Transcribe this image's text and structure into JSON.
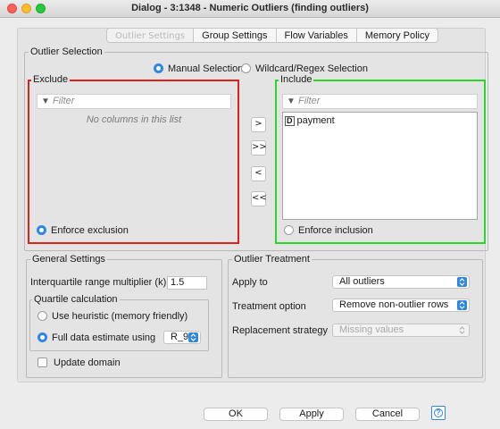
{
  "window": {
    "title": "Dialog - 3:1348 - Numeric Outliers (finding outliers)"
  },
  "tabs": [
    {
      "label": "Outlier Settings"
    },
    {
      "label": "Group Settings"
    },
    {
      "label": "Flow Variables"
    },
    {
      "label": "Memory Policy"
    }
  ],
  "outlier_selection": {
    "legend": "Outlier Selection",
    "mode_manual": "Manual Selection",
    "mode_wildcard": "Wildcard/Regex Selection",
    "exclude": {
      "legend": "Exclude",
      "filter_placeholder": "Filter",
      "empty_text": "No columns in this list",
      "enforce": "Enforce exclusion"
    },
    "include": {
      "legend": "Include",
      "filter_placeholder": "Filter",
      "items": [
        {
          "type": "D",
          "name": "payment"
        }
      ],
      "enforce": "Enforce inclusion"
    },
    "move_buttons": [
      ">",
      ">>",
      "<",
      "<<"
    ]
  },
  "general": {
    "legend": "General Settings",
    "iqr_label": "Interquartile range multiplier (k)",
    "iqr_value": "1.5",
    "quartile": {
      "legend": "Quartile calculation",
      "heuristic": "Use heuristic (memory friendly)",
      "full": "Full data estimate using",
      "estimator": "R_9"
    },
    "update_domain": "Update domain"
  },
  "treatment": {
    "legend": "Outlier Treatment",
    "apply_to_label": "Apply to",
    "apply_to_value": "All outliers",
    "option_label": "Treatment option",
    "option_value": "Remove non-outlier rows",
    "replacement_label": "Replacement strategy",
    "replacement_value": "Missing values"
  },
  "footer": {
    "ok": "OK",
    "apply": "Apply",
    "cancel": "Cancel",
    "help": "?"
  },
  "colors": {
    "accent": "#2e86e6",
    "exclude_border": "#e0201b",
    "include_border": "#2bd62b"
  }
}
